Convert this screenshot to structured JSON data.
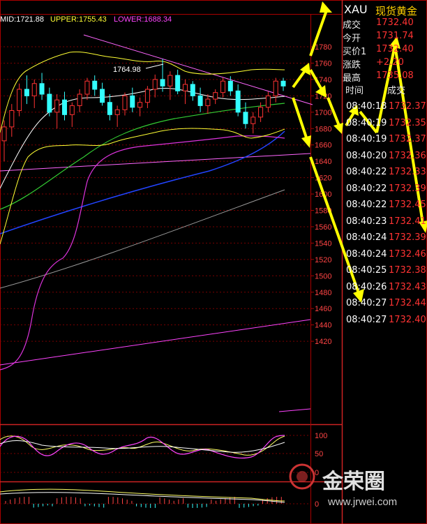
{
  "indicator": {
    "mid_label": "MID:1721.88",
    "upper_label": "UPPER:1755.43",
    "lower_label": "LOWER:1688.34"
  },
  "chart_data": {
    "type": "candlestick",
    "price_axis_ticks": [
      "1780",
      "1760",
      "1740",
      "1720",
      "1700",
      "1680",
      "1660",
      "1640",
      "1620",
      "1600",
      "1580",
      "1560",
      "1540",
      "1520",
      "1500",
      "1480",
      "1460",
      "1440",
      "1420"
    ],
    "price_ylim": [
      1420,
      1790
    ],
    "high_annotation": "1764.98",
    "osc1_ticks": [
      "100",
      "50",
      "0"
    ],
    "osc2_ticks": [
      "0"
    ],
    "candles": [
      {
        "o": 1665,
        "h": 1690,
        "l": 1640,
        "c": 1682
      },
      {
        "o": 1682,
        "h": 1710,
        "l": 1670,
        "c": 1702
      },
      {
        "o": 1702,
        "h": 1735,
        "l": 1695,
        "c": 1728
      },
      {
        "o": 1728,
        "h": 1745,
        "l": 1710,
        "c": 1720
      },
      {
        "o": 1720,
        "h": 1740,
        "l": 1705,
        "c": 1735
      },
      {
        "o": 1735,
        "h": 1748,
        "l": 1715,
        "c": 1722
      },
      {
        "o": 1722,
        "h": 1730,
        "l": 1695,
        "c": 1700
      },
      {
        "o": 1700,
        "h": 1722,
        "l": 1680,
        "c": 1715
      },
      {
        "o": 1715,
        "h": 1725,
        "l": 1690,
        "c": 1697
      },
      {
        "o": 1697,
        "h": 1712,
        "l": 1682,
        "c": 1708
      },
      {
        "o": 1708,
        "h": 1728,
        "l": 1700,
        "c": 1722
      },
      {
        "o": 1722,
        "h": 1742,
        "l": 1715,
        "c": 1738
      },
      {
        "o": 1738,
        "h": 1745,
        "l": 1720,
        "c": 1728
      },
      {
        "o": 1728,
        "h": 1736,
        "l": 1708,
        "c": 1712
      },
      {
        "o": 1712,
        "h": 1722,
        "l": 1690,
        "c": 1697
      },
      {
        "o": 1697,
        "h": 1708,
        "l": 1682,
        "c": 1703
      },
      {
        "o": 1703,
        "h": 1724,
        "l": 1696,
        "c": 1720
      },
      {
        "o": 1720,
        "h": 1730,
        "l": 1700,
        "c": 1706
      },
      {
        "o": 1706,
        "h": 1718,
        "l": 1695,
        "c": 1712
      },
      {
        "o": 1712,
        "h": 1732,
        "l": 1705,
        "c": 1728
      },
      {
        "o": 1728,
        "h": 1746,
        "l": 1718,
        "c": 1740
      },
      {
        "o": 1740,
        "h": 1765,
        "l": 1725,
        "c": 1732
      },
      {
        "o": 1732,
        "h": 1750,
        "l": 1715,
        "c": 1745
      },
      {
        "o": 1745,
        "h": 1752,
        "l": 1722,
        "c": 1726
      },
      {
        "o": 1726,
        "h": 1740,
        "l": 1710,
        "c": 1734
      },
      {
        "o": 1734,
        "h": 1738,
        "l": 1714,
        "c": 1720
      },
      {
        "o": 1720,
        "h": 1730,
        "l": 1700,
        "c": 1708
      },
      {
        "o": 1708,
        "h": 1722,
        "l": 1698,
        "c": 1716
      },
      {
        "o": 1716,
        "h": 1728,
        "l": 1710,
        "c": 1724
      },
      {
        "o": 1724,
        "h": 1742,
        "l": 1718,
        "c": 1738
      },
      {
        "o": 1738,
        "h": 1744,
        "l": 1720,
        "c": 1726
      },
      {
        "o": 1726,
        "h": 1734,
        "l": 1695,
        "c": 1700
      },
      {
        "o": 1700,
        "h": 1712,
        "l": 1680,
        "c": 1686
      },
      {
        "o": 1686,
        "h": 1700,
        "l": 1674,
        "c": 1694
      },
      {
        "o": 1694,
        "h": 1712,
        "l": 1688,
        "c": 1706
      },
      {
        "o": 1706,
        "h": 1725,
        "l": 1700,
        "c": 1720
      },
      {
        "o": 1720,
        "h": 1742,
        "l": 1712,
        "c": 1738
      },
      {
        "o": 1738,
        "h": 1742,
        "l": 1726,
        "c": 1732
      }
    ]
  },
  "quote": {
    "symbol": "XAU",
    "name": "现货黄金",
    "rows": [
      {
        "label": "成交",
        "value": "1732.40"
      },
      {
        "label": "今开",
        "value": "1731.74"
      },
      {
        "label": "买价1",
        "value": "1732.40"
      },
      {
        "label": "涨跌",
        "value": "+2.20"
      },
      {
        "label": "最高",
        "value": "1735.08"
      }
    ]
  },
  "ticks": {
    "header_time": "时间",
    "header_price": "成交",
    "rows": [
      {
        "time": "08:40:18",
        "price": "1732.37"
      },
      {
        "time": "08:40:19",
        "price": "1732.35"
      },
      {
        "time": "08:40:19",
        "price": "1732.37"
      },
      {
        "time": "08:40:20",
        "price": "1732.36"
      },
      {
        "time": "08:40:22",
        "price": "1732.33"
      },
      {
        "time": "08:40:22",
        "price": "1732.39"
      },
      {
        "time": "08:40:22",
        "price": "1732.45"
      },
      {
        "time": "08:40:23",
        "price": "1732.41"
      },
      {
        "time": "08:40:24",
        "price": "1732.39"
      },
      {
        "time": "08:40:24",
        "price": "1732.46"
      },
      {
        "time": "08:40:25",
        "price": "1732.38"
      },
      {
        "time": "08:40:26",
        "price": "1732.43"
      },
      {
        "time": "08:40:27",
        "price": "1732.44"
      },
      {
        "time": "08:40:27",
        "price": "1732.40"
      }
    ]
  },
  "watermark": {
    "brand": "金荣圈",
    "url": "www.jrwei.com"
  },
  "colors": {
    "up": "#ff3333",
    "down": "#33ffff",
    "mid": "#ffffff",
    "upper": "#ffff33",
    "lower": "#ff44ff",
    "grid": "#7a0000",
    "arrow": "#ffff00",
    "ma_green": "#33cc33",
    "ma_blue": "#2244ff"
  }
}
